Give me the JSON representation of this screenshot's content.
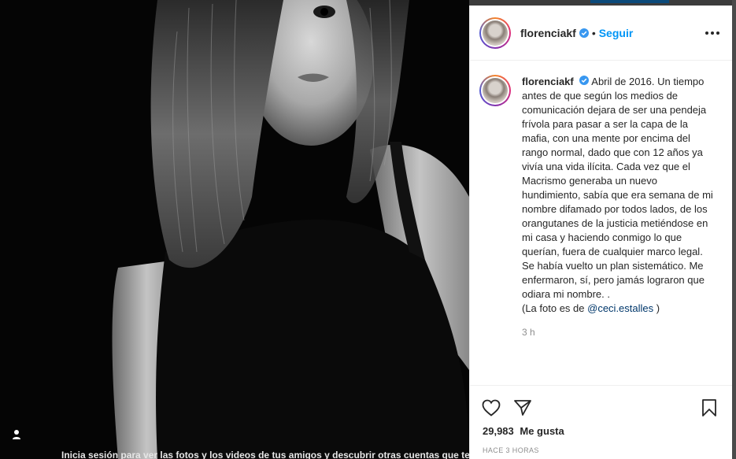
{
  "post": {
    "username": "florenciakf",
    "follow_label": "Seguir",
    "separator": "•",
    "caption_start": "Abril de 2016. Un tiempo antes de que según los medios de comunicación dejara de ser una pendeja frívola para pasar a ser la capa de la mafia, con una mente por encima del rango normal, dado que con 12 años ya vivía una vida ilícita. Cada vez que el Macrismo generaba un nuevo hundimiento, sabía que era semana de mi nombre difamado por todos lados, de los orangutanes de la justicia metiéndose en mi casa y haciendo conmigo lo que querían, fuera de cualquier marco legal. Se había vuelto un plan sistemático. Me enfermaron, sí, pero jamás lograron que odiara mi nombre. .",
    "caption_credit_prefix": "(La foto es de ",
    "caption_mention": "@ceci.estalles",
    "caption_credit_suffix": " )",
    "time": "3 h",
    "likes_count": "29,983",
    "likes_word": "Me gusta",
    "posted_ago": "HACE 3 HORAS"
  },
  "banner": {
    "text": "Inicia sesión para ver las fotos y los videos de tus amigos y descubrir otras cuentas que te encantarán."
  },
  "colors": {
    "link_blue": "#0095f6",
    "mention": "#00376b",
    "text": "#262626",
    "muted": "#8e8e8e"
  },
  "icons": [
    "verified-badge-icon",
    "more-options-icon",
    "heart-icon",
    "share-icon",
    "bookmark-icon",
    "user-icon"
  ]
}
